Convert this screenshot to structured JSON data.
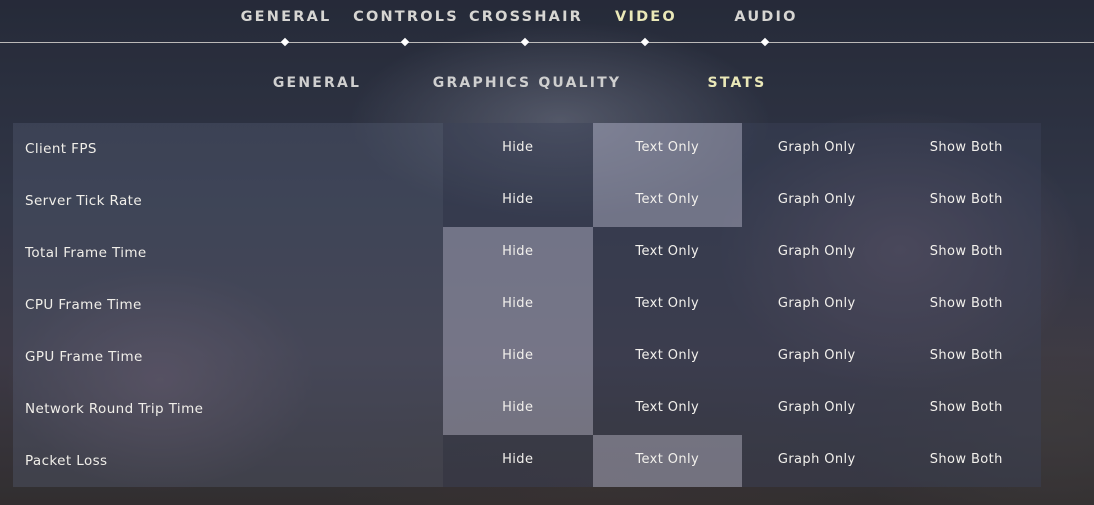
{
  "top_nav": {
    "items": [
      {
        "label": "GENERAL",
        "active": false
      },
      {
        "label": "CONTROLS",
        "active": false
      },
      {
        "label": "CROSSHAIR",
        "active": false
      },
      {
        "label": "VIDEO",
        "active": true
      },
      {
        "label": "AUDIO",
        "active": false
      }
    ]
  },
  "sub_nav": {
    "items": [
      {
        "label": "GENERAL",
        "active": false
      },
      {
        "label": "GRAPHICS QUALITY",
        "active": false
      },
      {
        "label": "STATS",
        "active": true
      }
    ]
  },
  "stats": {
    "options": [
      "Hide",
      "Text Only",
      "Graph Only",
      "Show Both"
    ],
    "rows": [
      {
        "label": "Client FPS",
        "selected": "Text Only"
      },
      {
        "label": "Server Tick Rate",
        "selected": "Text Only"
      },
      {
        "label": "Total Frame Time",
        "selected": "Hide"
      },
      {
        "label": "CPU Frame Time",
        "selected": "Hide"
      },
      {
        "label": "GPU Frame Time",
        "selected": "Hide"
      },
      {
        "label": "Network Round Trip Time",
        "selected": "Hide"
      },
      {
        "label": "Packet Loss",
        "selected": "Text Only"
      }
    ]
  },
  "colors": {
    "active_accent": "#eae8b8",
    "text": "#ece8e1"
  }
}
